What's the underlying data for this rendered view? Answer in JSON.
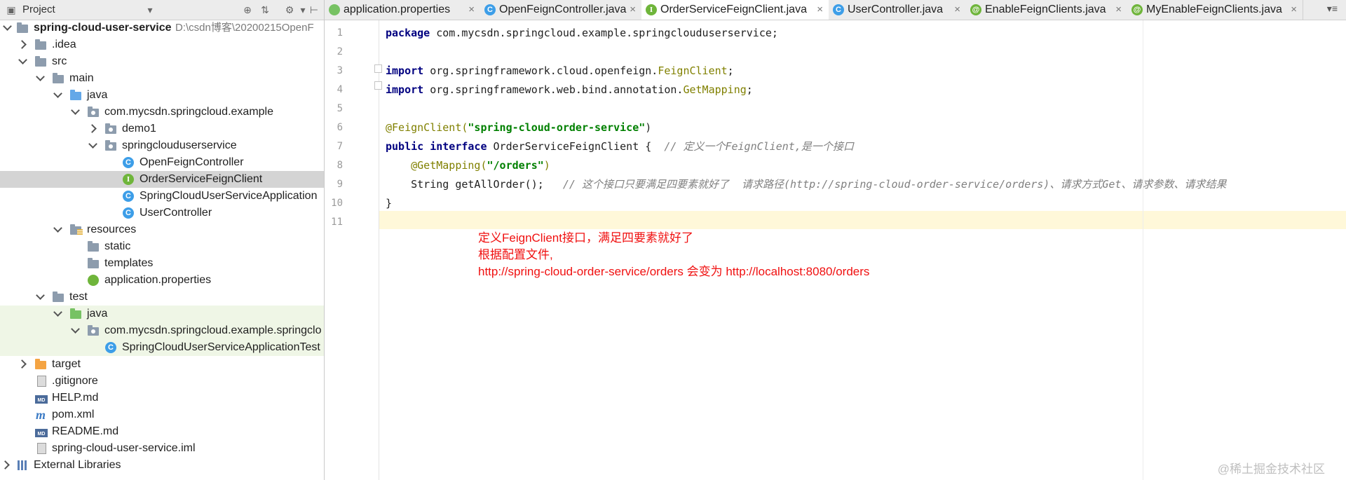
{
  "project_panel": {
    "title": "Project",
    "tree": [
      {
        "label": "spring-cloud-user-service",
        "path": "D:\\csdn博客\\20200215OpenF",
        "bold": true
      },
      {
        "label": ".idea"
      },
      {
        "label": "src"
      },
      {
        "label": "main"
      },
      {
        "label": "java"
      },
      {
        "label": "com.mycsdn.springcloud.example"
      },
      {
        "label": "demo1"
      },
      {
        "label": "springclouduserservice"
      },
      {
        "label": "OpenFeignController"
      },
      {
        "label": "OrderServiceFeignClient"
      },
      {
        "label": "SpringCloudUserServiceApplication"
      },
      {
        "label": "UserController"
      },
      {
        "label": "resources"
      },
      {
        "label": "static"
      },
      {
        "label": "templates"
      },
      {
        "label": "application.properties"
      },
      {
        "label": "test"
      },
      {
        "label": "java"
      },
      {
        "label": "com.mycsdn.springcloud.example.springclo"
      },
      {
        "label": "SpringCloudUserServiceApplicationTest"
      },
      {
        "label": "target"
      },
      {
        "label": ".gitignore"
      },
      {
        "label": "HELP.md"
      },
      {
        "label": "pom.xml"
      },
      {
        "label": "README.md"
      },
      {
        "label": "spring-cloud-user-service.iml"
      },
      {
        "label": "External Libraries"
      }
    ]
  },
  "tabs": [
    {
      "label": "application.properties",
      "icon": "properties-icon"
    },
    {
      "label": "OpenFeignController.java",
      "icon": "class-icon"
    },
    {
      "label": "OrderServiceFeignClient.java",
      "icon": "interface-icon",
      "active": true
    },
    {
      "label": "UserController.java",
      "icon": "class-icon"
    },
    {
      "label": "EnableFeignClients.java",
      "icon": "annotation-icon"
    },
    {
      "label": "MyEnableFeignClients.java",
      "icon": "annotation-icon"
    }
  ],
  "editor": {
    "line_numbers": [
      "1",
      "2",
      "3",
      "4",
      "5",
      "6",
      "7",
      "8",
      "9",
      "10",
      "11"
    ],
    "lines": {
      "l1_kw": "package",
      "l1_rest": " com.mycsdn.springcloud.example.springclouduserservice;",
      "l3_kw": "import",
      "l3_a": " org.springframework.cloud.openfeign.",
      "l3_b": "FeignClient",
      "l3_c": ";",
      "l4_kw": "import",
      "l4_a": " org.springframework.web.bind.annotation.",
      "l4_b": "GetMapping",
      "l4_c": ";",
      "l6_ann": "@FeignClient(",
      "l6_str": "\"spring-cloud-order-service\"",
      "l6_end": ")",
      "l7_kw": "public interface",
      "l7_rest": " OrderServiceFeignClient {  ",
      "l7_cmt": "// 定义一个FeignClient,是一个接口",
      "l8_ann": "    @GetMapping(",
      "l8_str": "\"/orders\"",
      "l8_end": ")",
      "l9_code": "    String getAllOrder();   ",
      "l9_cmt": "// 这个接口只要满足四要素就好了  请求路径(http://spring-cloud-order-service/orders)、请求方式Get、请求参数、请求结果",
      "l10": "}"
    }
  },
  "annotation_note": [
    "定义FeignClient接口，满足四要素就好了",
    "根据配置文件,",
    "http://spring-cloud-order-service/orders 会变为 http://localhost:8080/orders"
  ],
  "watermark": "@稀土掘金技术社区",
  "colors": {
    "keyword": "#000080",
    "annotation": "#808000",
    "string": "#008000",
    "comment": "#808080",
    "note": "#f01010"
  }
}
